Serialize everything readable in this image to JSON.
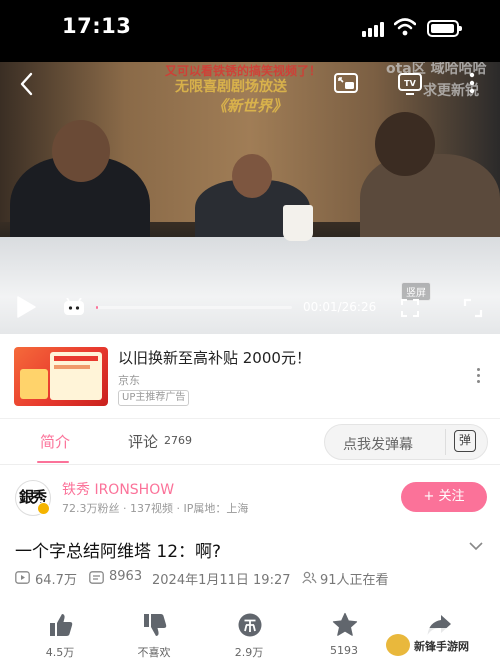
{
  "status_bar": {
    "time": "17:13"
  },
  "video": {
    "captions": [
      "又可以看铁锈的搞笑视频了！",
      "无限喜剧剧场放送",
      "《新世界》",
      "ota区 域哈哈哈",
      "求更新锐"
    ],
    "current_time": "00:01",
    "duration": "26:26",
    "time_display": "00:01/26:26",
    "progress_fraction": 0.001,
    "portrait_label": "竖屏",
    "icons": [
      "back-icon",
      "picture-in-picture-icon",
      "tv-cast-icon",
      "more-icon",
      "play-icon",
      "danmaku-icon",
      "fullscreen-icon"
    ]
  },
  "ad": {
    "title": "以旧换新至高补贴 2000元！",
    "brand": "京东",
    "tag": "UP主推荐广告"
  },
  "tabs": {
    "intro_label": "简介",
    "comments_label": "评论",
    "comments_count": "2769",
    "danmaku_placeholder": "点我发弹幕",
    "danmaku_button": "弹"
  },
  "uploader": {
    "avatar_text": "銀秀",
    "name": "铁秀 IRONSHOW",
    "stats": "72.3万粉丝 · 137视频 · IP属地：上海",
    "follow_label": "+ 关注"
  },
  "video_info": {
    "title": "一个字总结阿维塔 12：啊?",
    "views": "64.7万",
    "danmaku_count": "8963",
    "publish_time": "2024年1月11日 19:27",
    "watching_now": "91人正在看"
  },
  "actions": [
    {
      "name": "like",
      "label": "4.5万",
      "icon": "thumbs-up-icon"
    },
    {
      "name": "dislike",
      "label": "不喜欢",
      "icon": "thumbs-down-icon"
    },
    {
      "name": "coin",
      "label": "2.9万",
      "icon": "coin-icon"
    },
    {
      "name": "favorite",
      "label": "5193",
      "icon": "star-icon"
    },
    {
      "name": "share",
      "label": "",
      "icon": "share-icon"
    }
  ],
  "watermark": {
    "text": "新锋手游网"
  },
  "colors": {
    "accent": "#fb7299",
    "text": "#222222",
    "muted": "#999999"
  }
}
